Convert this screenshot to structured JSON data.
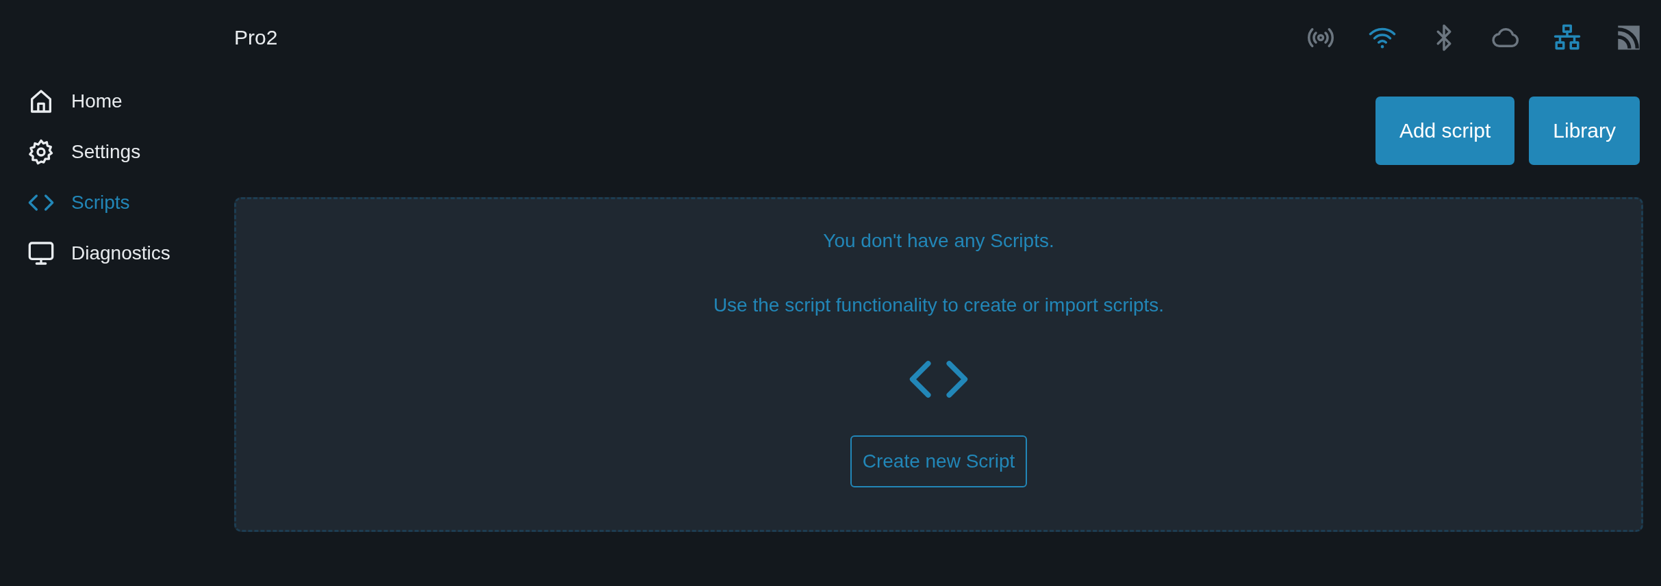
{
  "header": {
    "title": "Pro2",
    "status_icons": [
      {
        "kind": "radio",
        "on": false
      },
      {
        "kind": "wifi",
        "on": true
      },
      {
        "kind": "bluetooth",
        "on": false
      },
      {
        "kind": "cloud",
        "on": false
      },
      {
        "kind": "network",
        "on": true
      },
      {
        "kind": "feed",
        "on": false
      }
    ]
  },
  "sidebar": {
    "items": [
      {
        "kind": "home",
        "label": "Home",
        "selected": false
      },
      {
        "kind": "gear",
        "label": "Settings",
        "selected": false
      },
      {
        "kind": "code",
        "label": "Scripts",
        "selected": true
      },
      {
        "kind": "monitor",
        "label": "Diagnostics",
        "selected": false
      }
    ]
  },
  "toolbar": {
    "buttons": [
      "Add script",
      "Library"
    ]
  },
  "empty_state": {
    "title": "You don't have any Scripts.",
    "message": "Use the script functionality to create or import scripts.",
    "button": "Create new Script"
  }
}
